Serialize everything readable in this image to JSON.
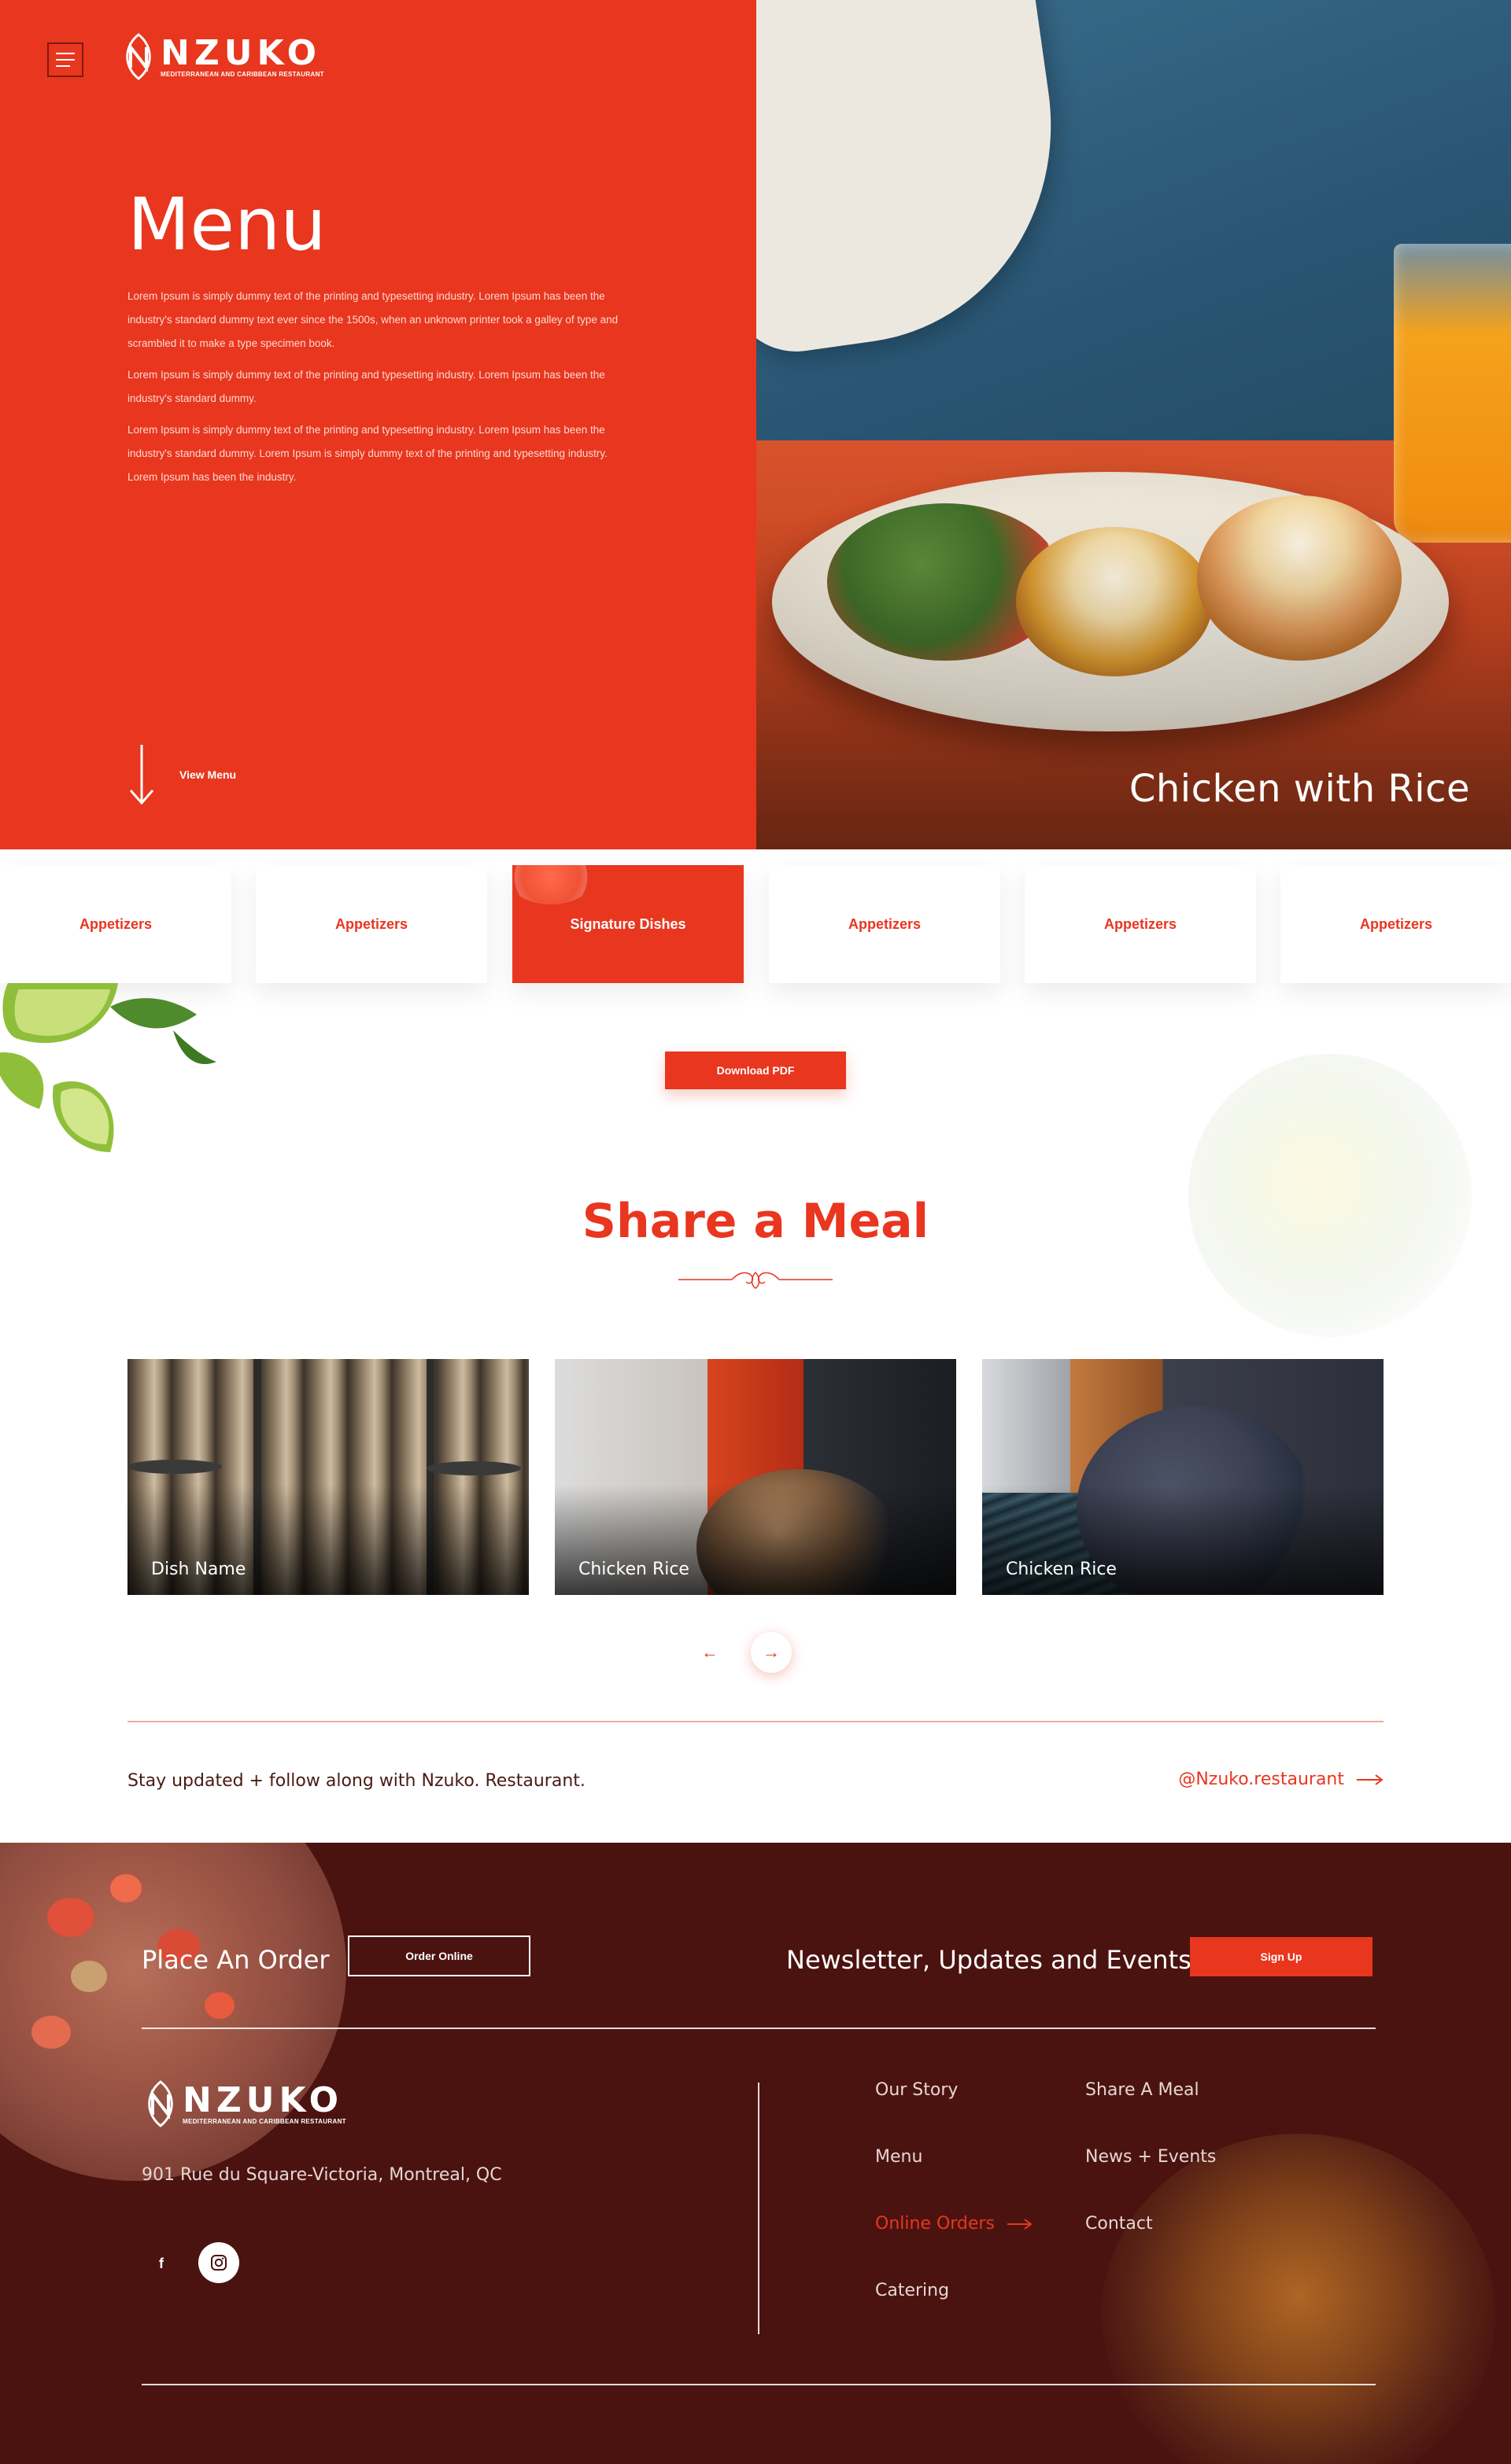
{
  "header": {
    "logo_word": "NZUKO",
    "logo_tagline": "MEDITERRANEAN AND CARIBBEAN RESTAURANT"
  },
  "hero": {
    "title": "Menu",
    "paragraphs": [
      "Lorem Ipsum is simply dummy text of the printing and typesetting industry. Lorem Ipsum has been the industry's standard dummy text ever since the 1500s, when an unknown printer took a galley of type and scrambled it to make a type specimen book.",
      "Lorem Ipsum is simply dummy text of the printing and typesetting industry. Lorem Ipsum has been the industry's standard dummy.",
      "Lorem Ipsum is simply dummy text of the printing and typesetting industry. Lorem Ipsum has been the industry's standard dummy. Lorem Ipsum is simply dummy text of the printing and typesetting industry. Lorem Ipsum has been the industry."
    ],
    "view_menu_label": "View Menu",
    "dish_title": "Chicken with Rice"
  },
  "tabs": [
    {
      "label": "Appetizers",
      "active": false
    },
    {
      "label": "Appetizers",
      "active": false
    },
    {
      "label": "Signature Dishes",
      "active": true
    },
    {
      "label": "Appetizers",
      "active": false
    },
    {
      "label": "Appetizers",
      "active": false
    },
    {
      "label": "Appetizers",
      "active": false
    }
  ],
  "download_label": "Download PDF",
  "share": {
    "title": "Share a Meal",
    "cards": [
      {
        "caption": "Dish Name"
      },
      {
        "caption": "Chicken Rice"
      },
      {
        "caption": "Chicken Rice"
      }
    ],
    "prev_icon": "←",
    "next_icon": "→"
  },
  "follow": {
    "text": "Stay updated + follow along with Nzuko. Restaurant.",
    "handle": "@Nzuko.restaurant"
  },
  "footer": {
    "order_title": "Place An Order",
    "order_button": "Order Online",
    "news_title": "Newsletter, Updates and Events",
    "signup_button": "Sign Up",
    "address": "901 Rue du Square-Victoria, Montreal, QC",
    "facebook_glyph": "f",
    "nav": [
      {
        "label": "Our Story"
      },
      {
        "label": "Menu"
      },
      {
        "label": "Online Orders"
      },
      {
        "label": "Catering"
      },
      {
        "label": "Share A Meal"
      },
      {
        "label": "News + Events"
      },
      {
        "label": "Contact"
      }
    ]
  },
  "colors": {
    "brand_red": "#e8361f",
    "footer_bg": "#4a1310"
  }
}
